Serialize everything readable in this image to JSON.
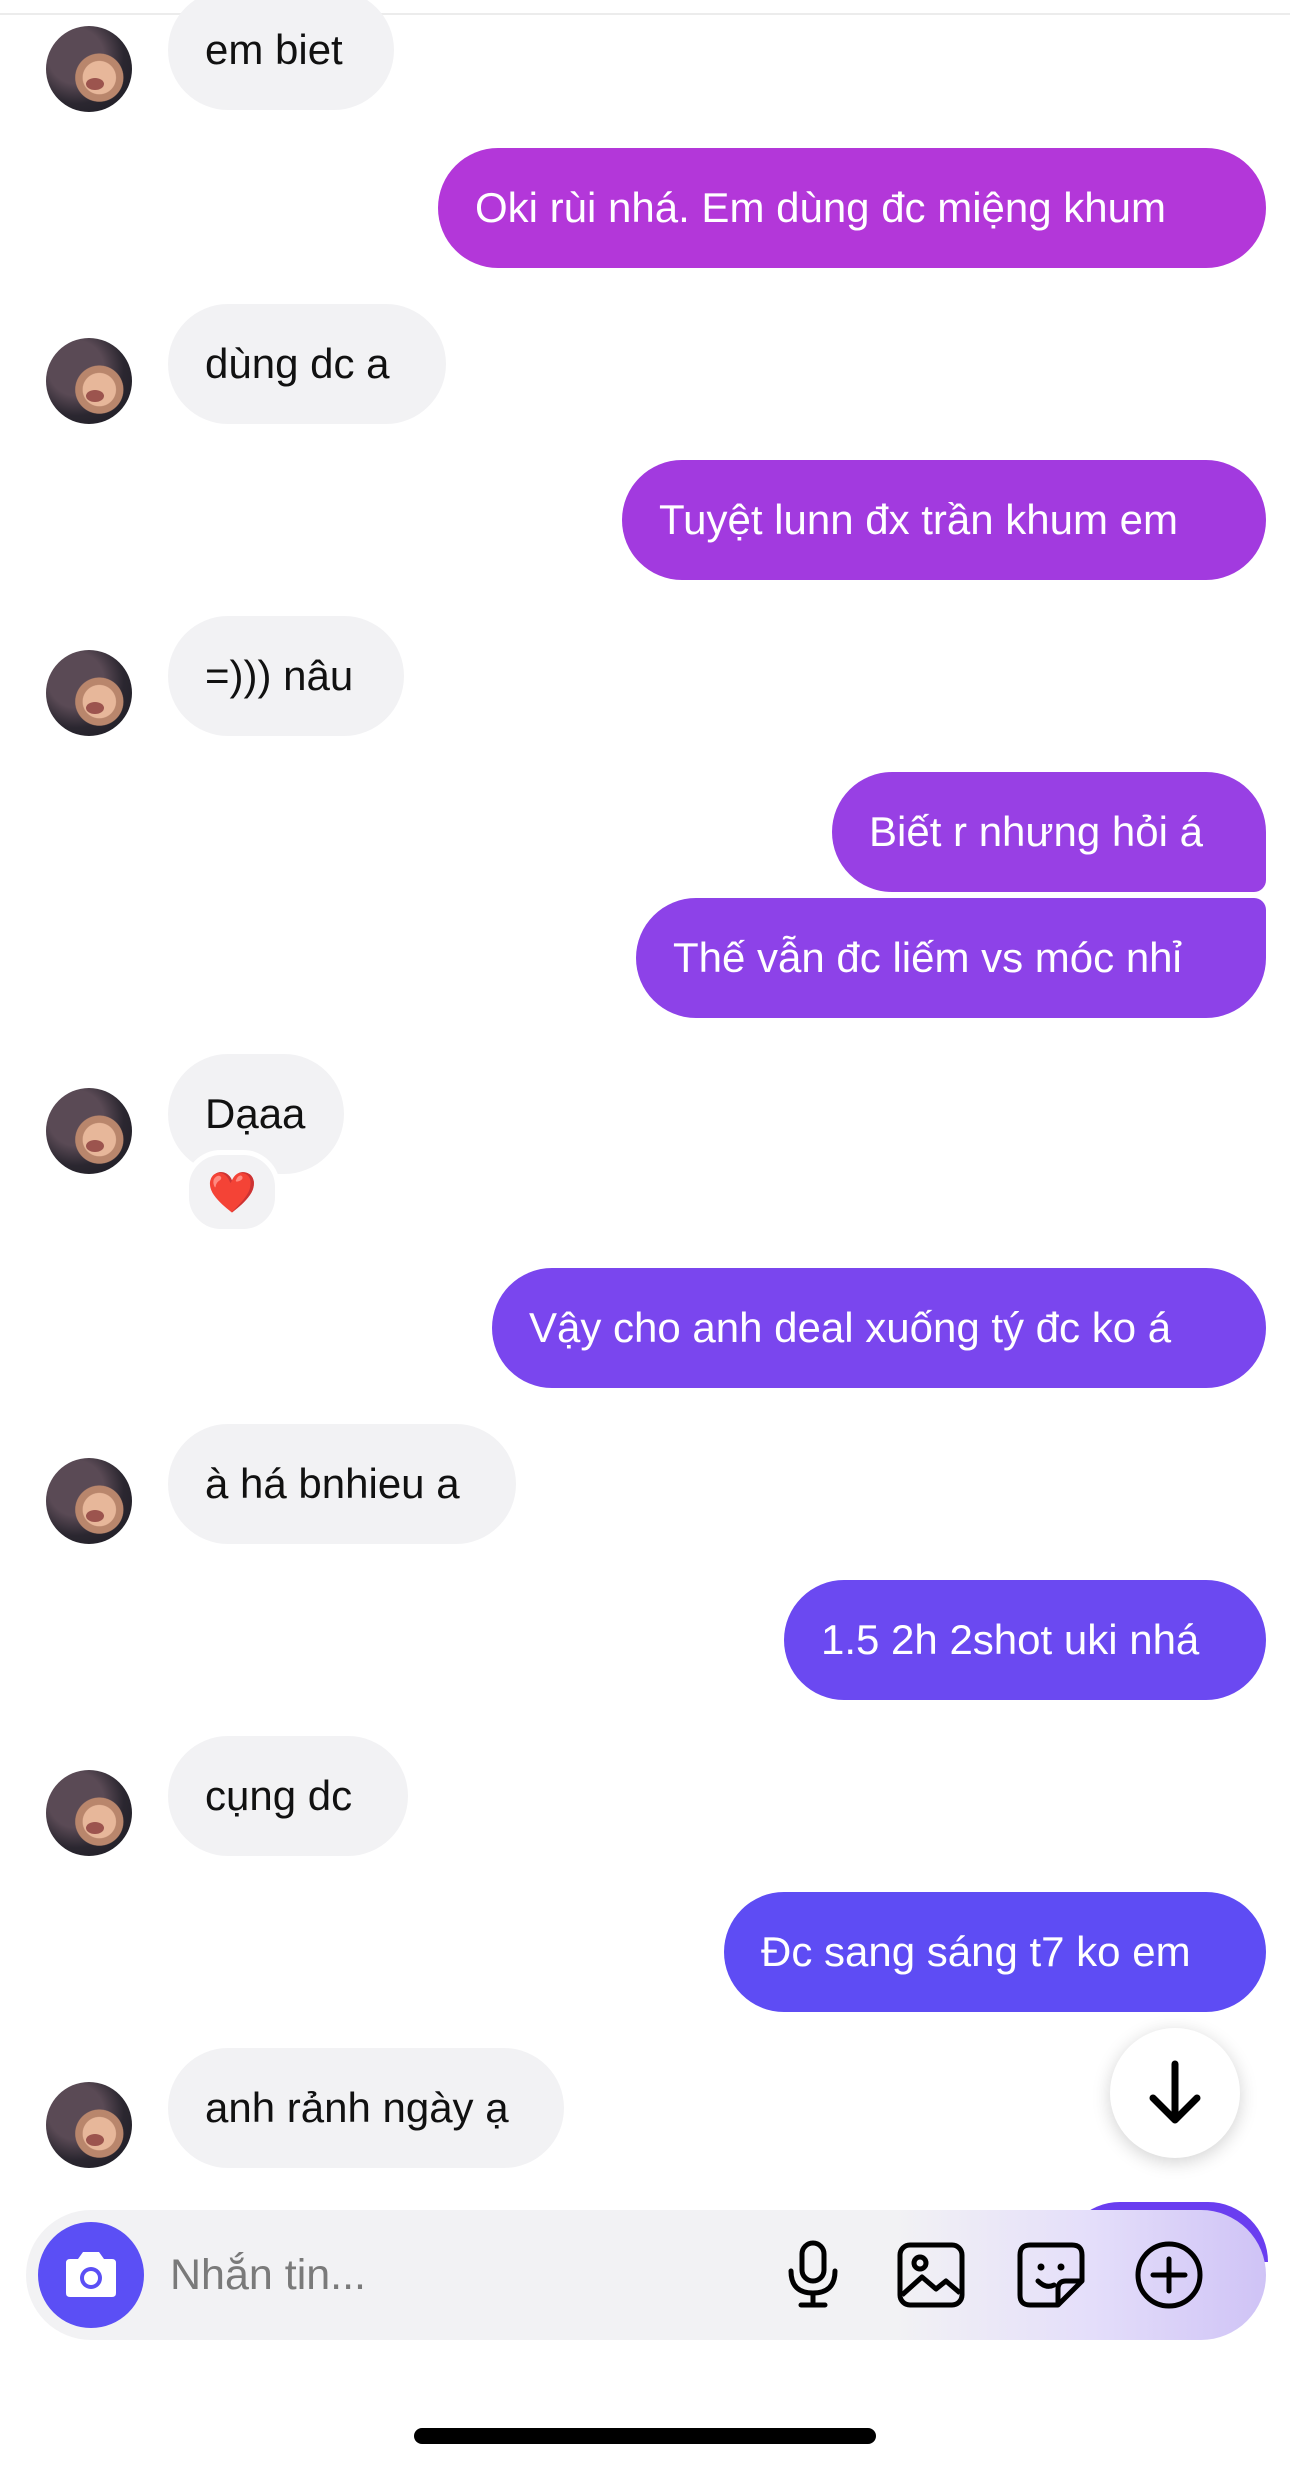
{
  "composer": {
    "placeholder": "Nhắn tin..."
  },
  "messages": [
    {
      "text": "em biet"
    },
    {
      "text": "Oki rùi nhá. Em dùng đc miệng khum"
    },
    {
      "text": "dùng dc a"
    },
    {
      "text": "Tuyệt lunn đx trần khum em"
    },
    {
      "text": "=))) nâu"
    },
    {
      "text": "Biết r nhưng hỏi á"
    },
    {
      "text": "Thế vẫn đc liếm vs móc nhỉ"
    },
    {
      "text": "Dạaa",
      "reaction": "❤️"
    },
    {
      "text": "Vậy cho anh deal xuống tý đc ko á"
    },
    {
      "text": "à há bnhieu a"
    },
    {
      "text": "1.5 2h 2shot uki nhá"
    },
    {
      "text": "cụng dc"
    },
    {
      "text": "Đc sang sáng t7 ko em"
    },
    {
      "text": "anh rảnh ngày ạ"
    }
  ],
  "colors": {
    "incoming_bubble": "#f2f2f4",
    "outgoing_gradient": [
      "#b436d8",
      "#8e3ee6",
      "#6a46f2",
      "#5b4ff5"
    ],
    "camera_button": "#5b4ff5"
  },
  "icons": [
    "camera-icon",
    "microphone-icon",
    "image-icon",
    "sticker-icon",
    "plus-circle-icon",
    "arrow-down-icon"
  ]
}
